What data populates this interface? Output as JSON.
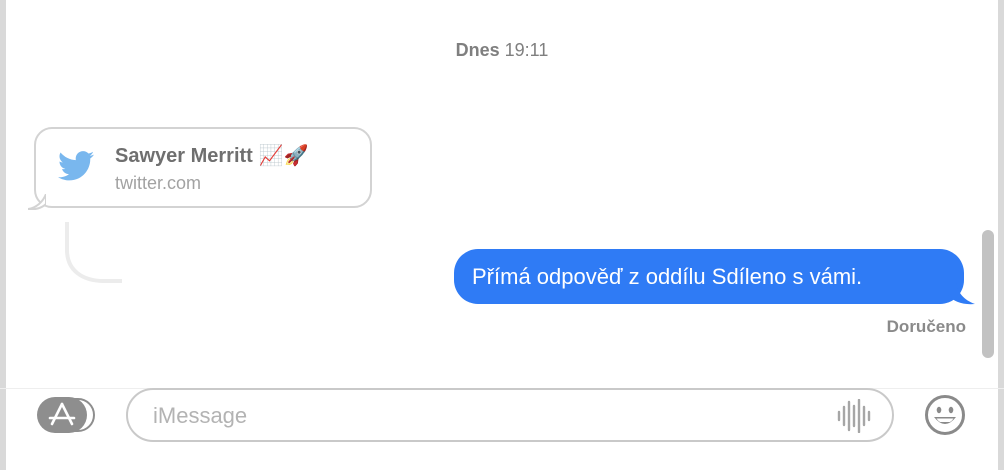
{
  "conversation": {
    "top_fragment": "",
    "timestamp": {
      "day": "Dnes",
      "time": "19:11"
    },
    "link_preview": {
      "title": "Sawyer Merritt",
      "emoji": "📈🚀",
      "host": "twitter.com",
      "icon": "twitter-bird-icon"
    },
    "sent_message": {
      "text": "Přímá odpověď z oddílu Sdíleno s vámi.",
      "color": "#2f7bf5"
    },
    "status": "Doručeno"
  },
  "composer": {
    "placeholder": "iMessage",
    "apps_icon": "app-store-icon",
    "audio_icon": "audio-waveform-icon",
    "emoji_icon": "emoji-icon"
  }
}
